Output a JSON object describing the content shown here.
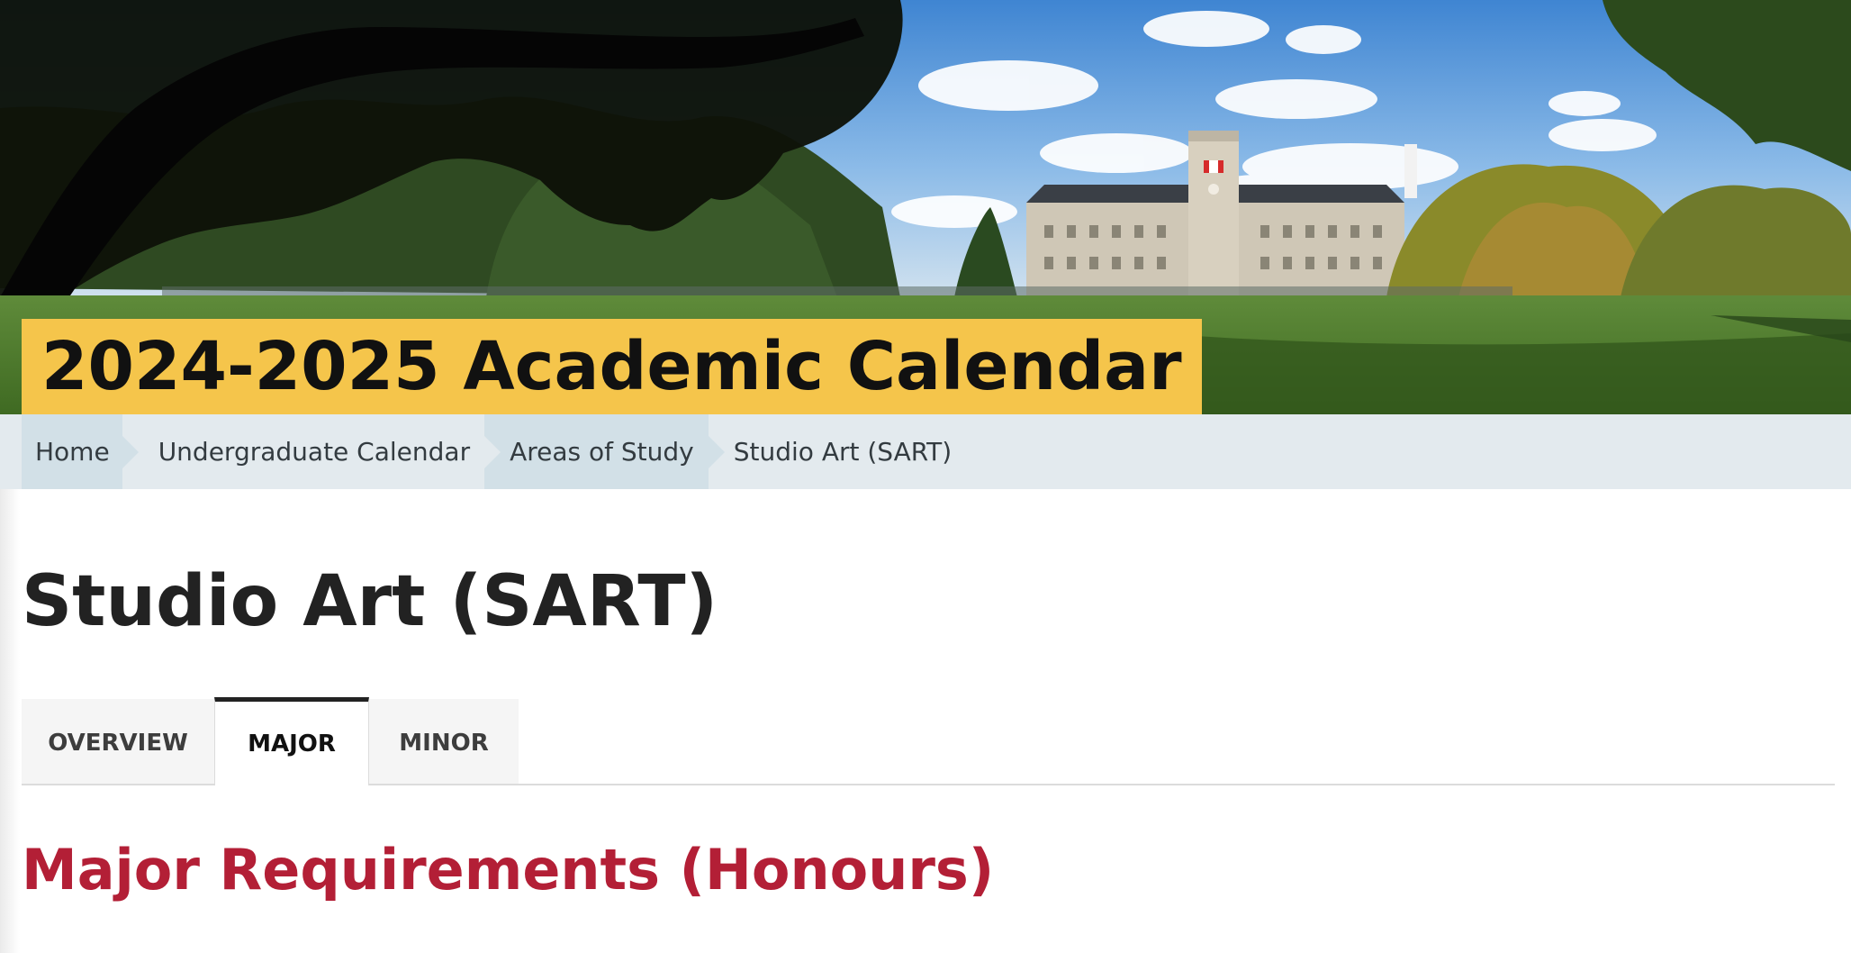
{
  "hero": {
    "title": "2024-2025 Academic Calendar",
    "title_background": "#f5c54b"
  },
  "breadcrumb": {
    "items": [
      {
        "label": "Home"
      },
      {
        "label": "Undergraduate Calendar"
      },
      {
        "label": "Areas of Study"
      },
      {
        "label": "Studio Art (SART)"
      }
    ]
  },
  "page": {
    "title": "Studio Art (SART)"
  },
  "tabs": {
    "items": [
      {
        "label": "OVERVIEW",
        "active": false
      },
      {
        "label": "MAJOR",
        "active": true
      },
      {
        "label": "MINOR",
        "active": false
      }
    ]
  },
  "content": {
    "section_heading": "Major Requirements (Honours)",
    "section_heading_color": "#b31f36"
  }
}
